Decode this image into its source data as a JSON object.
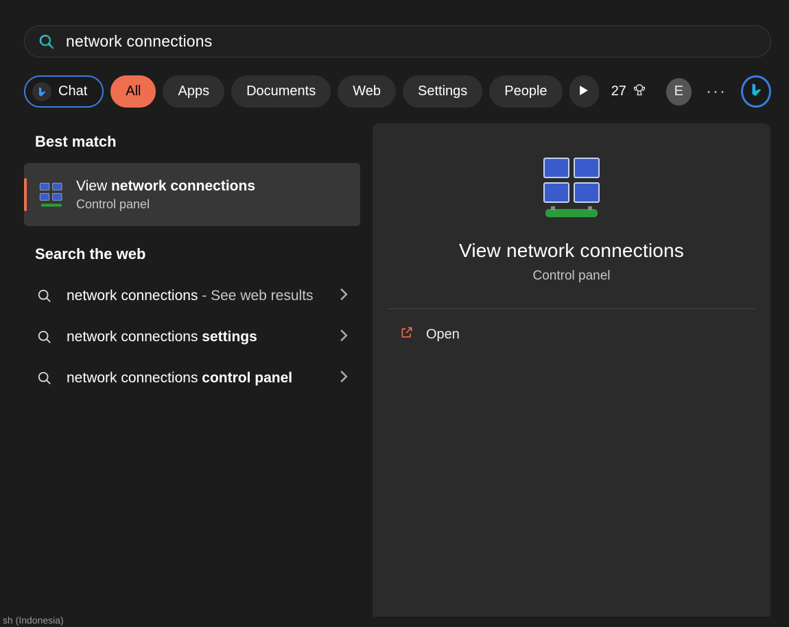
{
  "search": {
    "query": "network connections"
  },
  "filters": {
    "chat": "Chat",
    "tabs": [
      "All",
      "Apps",
      "Documents",
      "Web",
      "Settings",
      "People"
    ],
    "rewards": "27",
    "avatar_initial": "E"
  },
  "results": {
    "best_match_heading": "Best match",
    "best_match": {
      "title_prefix": "View ",
      "title_bold": "network connections",
      "subtitle": "Control panel"
    },
    "web_heading": "Search the web",
    "web_items": [
      {
        "plain": "network connections",
        "sep": " - ",
        "dim": "See web results",
        "bold": ""
      },
      {
        "plain": "network connections ",
        "sep": "",
        "dim": "",
        "bold": "settings"
      },
      {
        "plain": "network connections ",
        "sep": "",
        "dim": "",
        "bold": "control panel"
      }
    ]
  },
  "detail": {
    "title": "View network connections",
    "subtitle": "Control panel",
    "open_label": "Open"
  },
  "taskbar": {
    "lang": "sh (Indonesia)"
  }
}
